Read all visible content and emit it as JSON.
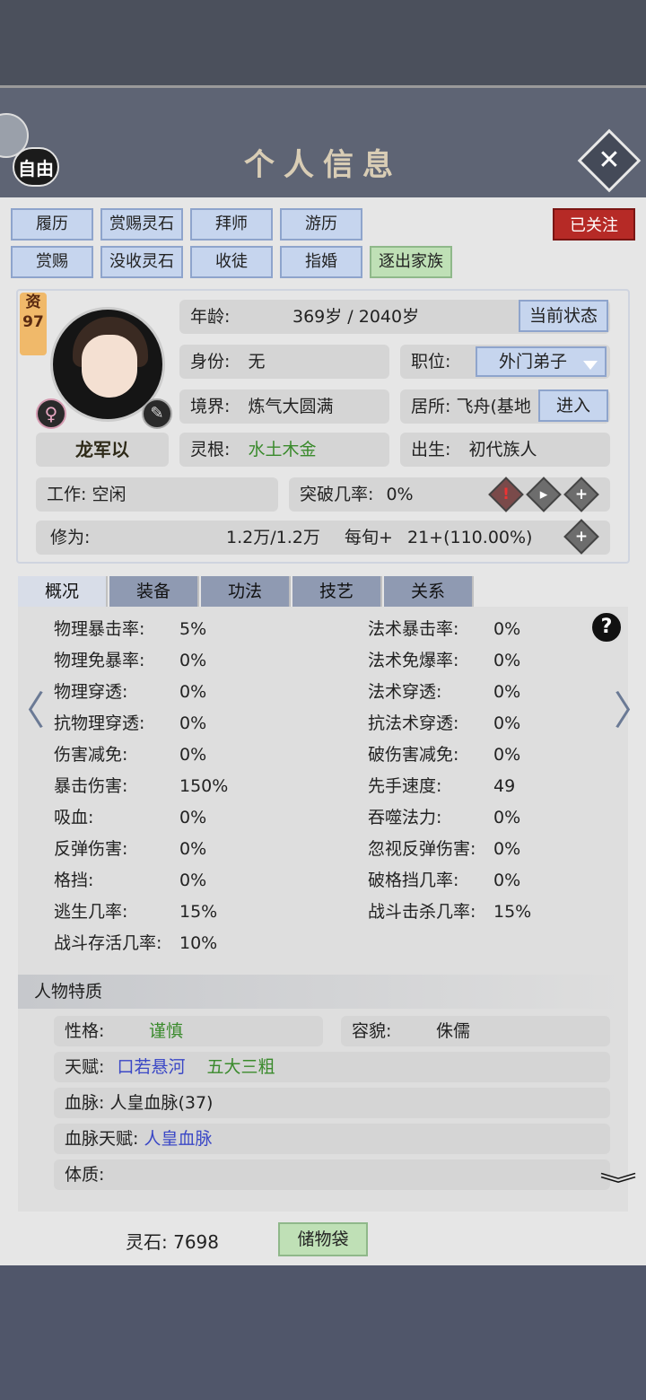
{
  "window": {
    "title": "个人信息",
    "mode_badge": "自由"
  },
  "actions_row1": [
    "履历",
    "赏赐灵石",
    "拜师",
    "游历"
  ],
  "actions_row2": [
    "赏赐",
    "没收灵石",
    "收徒",
    "指婚",
    "逐出家族"
  ],
  "follow_label": "已关注",
  "profile": {
    "aptitude_label": "资",
    "aptitude_value": "97",
    "gender_symbol": "♀",
    "name": "龙军以",
    "age_label": "年龄:",
    "age_value": "369岁 / 2040岁",
    "status_button": "当前状态",
    "identity_label": "身份:",
    "identity_value": "无",
    "position_label": "职位:",
    "position_value": "外门弟子",
    "realm_label": "境界:",
    "realm_value": "炼气大圆满",
    "residence_label": "居所:",
    "residence_value": "飞舟(基地",
    "enter_button": "进入",
    "root_label": "灵根:",
    "root_value": "水土木金",
    "birth_label": "出生:",
    "birth_value": "初代族人",
    "work_label": "工作:",
    "work_value": "空闲",
    "breakthrough_label": "突破几率:",
    "breakthrough_value": "0%",
    "cultivation_label": "修为:",
    "cultivation_value": "1.2万/1.2万",
    "per_turn_label": "每旬+",
    "per_turn_value": "21+(110.00%)"
  },
  "tabs": [
    "概况",
    "装备",
    "功法",
    "技艺",
    "关系"
  ],
  "stats_left": [
    {
      "label": "物理暴击率:",
      "value": "5%"
    },
    {
      "label": "物理免暴率:",
      "value": "0%"
    },
    {
      "label": "物理穿透:",
      "value": "0%"
    },
    {
      "label": "抗物理穿透:",
      "value": "0%"
    },
    {
      "label": "伤害减免:",
      "value": "0%"
    },
    {
      "label": "暴击伤害:",
      "value": "150%"
    },
    {
      "label": "吸血:",
      "value": "0%"
    },
    {
      "label": "反弹伤害:",
      "value": "0%"
    },
    {
      "label": "格挡:",
      "value": "0%"
    },
    {
      "label": "逃生几率:",
      "value": "15%"
    },
    {
      "label": "战斗存活几率:",
      "value": "10%"
    }
  ],
  "stats_right": [
    {
      "label": "法术暴击率:",
      "value": "0%"
    },
    {
      "label": "法术免爆率:",
      "value": "0%"
    },
    {
      "label": "法术穿透:",
      "value": "0%"
    },
    {
      "label": "抗法术穿透:",
      "value": "0%"
    },
    {
      "label": "破伤害减免:",
      "value": "0%"
    },
    {
      "label": "先手速度:",
      "value": "49"
    },
    {
      "label": "吞噬法力:",
      "value": "0%"
    },
    {
      "label": "忽视反弹伤害:",
      "value": "0%"
    },
    {
      "label": "破格挡几率:",
      "value": "0%"
    },
    {
      "label": "战斗击杀几率:",
      "value": "15%"
    }
  ],
  "traits": {
    "section_title": "人物特质",
    "personality_label": "性格:",
    "personality_value": "谨慎",
    "looks_label": "容貌:",
    "looks_value": "侏儒",
    "talent_label": "天赋:",
    "talent_1": "口若悬河",
    "talent_2": "五大三粗",
    "bloodline_label": "血脉:",
    "bloodline_value": "人皇血脉(37)",
    "bloodline_talent_label": "血脉天赋:",
    "bloodline_talent_value": "人皇血脉",
    "physique_label": "体质:"
  },
  "footer": {
    "spirit_stone": "灵石: 7698",
    "bag_button": "储物袋"
  },
  "colors": {
    "accent_green": "#3a8a2c",
    "accent_blue": "#3b48c6",
    "follow_red": "#b62a26"
  }
}
